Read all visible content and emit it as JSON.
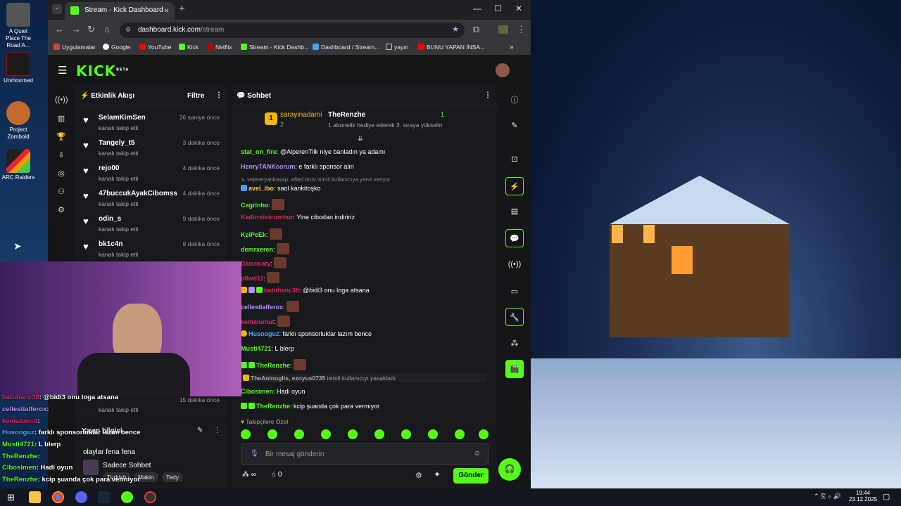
{
  "desktop": {
    "icons": [
      {
        "label": "A Quiet Place The Road A..."
      },
      {
        "label": "Unmourned"
      },
      {
        "label": "Project Zomboid"
      },
      {
        "label": "ARC Raiders"
      }
    ]
  },
  "browser": {
    "tab_title": "Stream - Kick Dashboard",
    "url_host": "dashboard.kick.com",
    "url_path": "/stream",
    "bookmarks": [
      "Uygulamalar",
      "Google",
      "YouTube",
      "Kick",
      "Netflix",
      "Stream - Kick Dashb...",
      "Dashboard / Stream...",
      "yayın",
      "BUNU YAPAN İNSA..."
    ]
  },
  "kick": {
    "logo": "KICK",
    "logo_beta": "BETA",
    "activity": {
      "title": "Etkinlik Akışı",
      "filter_label": "Filtre",
      "items": [
        {
          "user": "SelamKimSen",
          "action": "kanalı takip etti",
          "time": "26 saniye önce"
        },
        {
          "user": "Tangely_t5",
          "action": "kanalı takip etti",
          "time": "3 dakika önce"
        },
        {
          "user": "rejo00",
          "action": "kanalı takip etti",
          "time": "4 dakika önce"
        },
        {
          "user": "47buccukAyakCibomss",
          "action": "kanalı takip etti",
          "time": "4 dakika önce"
        },
        {
          "user": "odin_s",
          "action": "kanalı takip etti",
          "time": "9 dakika önce"
        },
        {
          "user": "bk1c4n",
          "action": "kanalı takip etti",
          "time": "9 dakika önce"
        },
        {
          "user": "",
          "action": "kanalı takip etti",
          "time": "15 dakika önce"
        }
      ]
    },
    "chat": {
      "title": "Sohbet",
      "pinned": {
        "rank": "1",
        "top_user": "sarayinadami",
        "top_count": "2",
        "gifter": "TheRenzhe",
        "gift_count": "1",
        "gift_text": "1 abonelik hediye ederek 3. sıraya yükselin"
      },
      "messages": [
        {
          "user": "stat_on_fire",
          "color": "#53fc18",
          "text": ": @AlperenTilk niye banladın ya adamı"
        },
        {
          "user": "HenryTANKcorum",
          "color": "#b48cff",
          "text": ": e farklı sponsor alın"
        },
        {
          "user": "vejeteryankasap",
          "color": "#888888",
          "text": ": afied bruv isimli kullanıcıya yanıt veriyor"
        },
        {
          "user": "avel_ibo",
          "color": "#ffd23f",
          "text": ": saol kankitoşko"
        },
        {
          "user": "Cagrinho",
          "color": "#53fc18",
          "text": ":"
        },
        {
          "user": "Kadirreisicumhur",
          "color": "#e0245e",
          "text": ": Yine cibodan indiririz"
        },
        {
          "user": "KelPeEk",
          "color": "#53fc18",
          "text": ":"
        },
        {
          "user": "demrxeren",
          "color": "#53fc18",
          "text": ":"
        },
        {
          "user": "Daisncaty",
          "color": "#e0245e",
          "text": ":"
        },
        {
          "user": "p0wd11",
          "color": "#e0245e",
          "text": ":"
        },
        {
          "user": "batuhanc38",
          "color": "#e0245e",
          "text": ": @bidi3 onu loga atsana"
        },
        {
          "user": "cellestialferox",
          "color": "#b48cff",
          "text": ":"
        },
        {
          "user": "kemalumut",
          "color": "#e0245e",
          "text": ":"
        },
        {
          "user": "Husooguz",
          "color": "#4aa3ff",
          "text": ": farklı sponsorluklar lazım bence"
        },
        {
          "user": "Musti4721",
          "color": "#53fc18",
          "text": ": L blerp"
        },
        {
          "user": "TheRenzhe",
          "color": "#53fc18",
          "text": ":"
        },
        {
          "user": "TheAninoglis, ezoyus0735",
          "color": "#888888",
          "text": " isimli kullanıcıyı yasakladı"
        },
        {
          "user": "Cibosimen",
          "color": "#53fc18",
          "text": ": Hadi oyun"
        },
        {
          "user": "TheRenzhe",
          "color": "#53fc18",
          "text": ": kcip şuanda çok para vermiyor"
        }
      ],
      "emote_section": "Takipçilere Özel",
      "input_placeholder": "Bir mesaj gönderin",
      "points": "∞",
      "gifts": "0",
      "send_label": "Gönder"
    },
    "stream_info": {
      "title": "Yayın bilgisi",
      "stream_title": "olaylar fena fena",
      "category": "Sadece Sohbet",
      "tags": [
        "Turkish",
        "Makin",
        "Tedy"
      ]
    }
  },
  "overlay_chat": [
    {
      "user": "batuhanc38",
      "text": ": @bidi3 onu loga atsana"
    },
    {
      "user": "cellestialferox",
      "text": ":"
    },
    {
      "user": "kemalumut",
      "text": ":"
    },
    {
      "user": "Husooguz",
      "text": ": farklı sponsorluklar lazım bence"
    },
    {
      "user": "Musti4721",
      "text": ": L blerp"
    },
    {
      "user": "TheRenzhe",
      "text": ":"
    },
    {
      "user": "Cibosimen",
      "text": ": Hadi oyun"
    },
    {
      "user": "TheRenzhe",
      "text": ": kcip şuanda çok para vermiyor"
    }
  ],
  "taskbar": {
    "time": "19:44",
    "date": "23.12.2025"
  },
  "colors": {
    "accent": "#53fc18",
    "bg": "#141517",
    "panel": "#18191c"
  }
}
